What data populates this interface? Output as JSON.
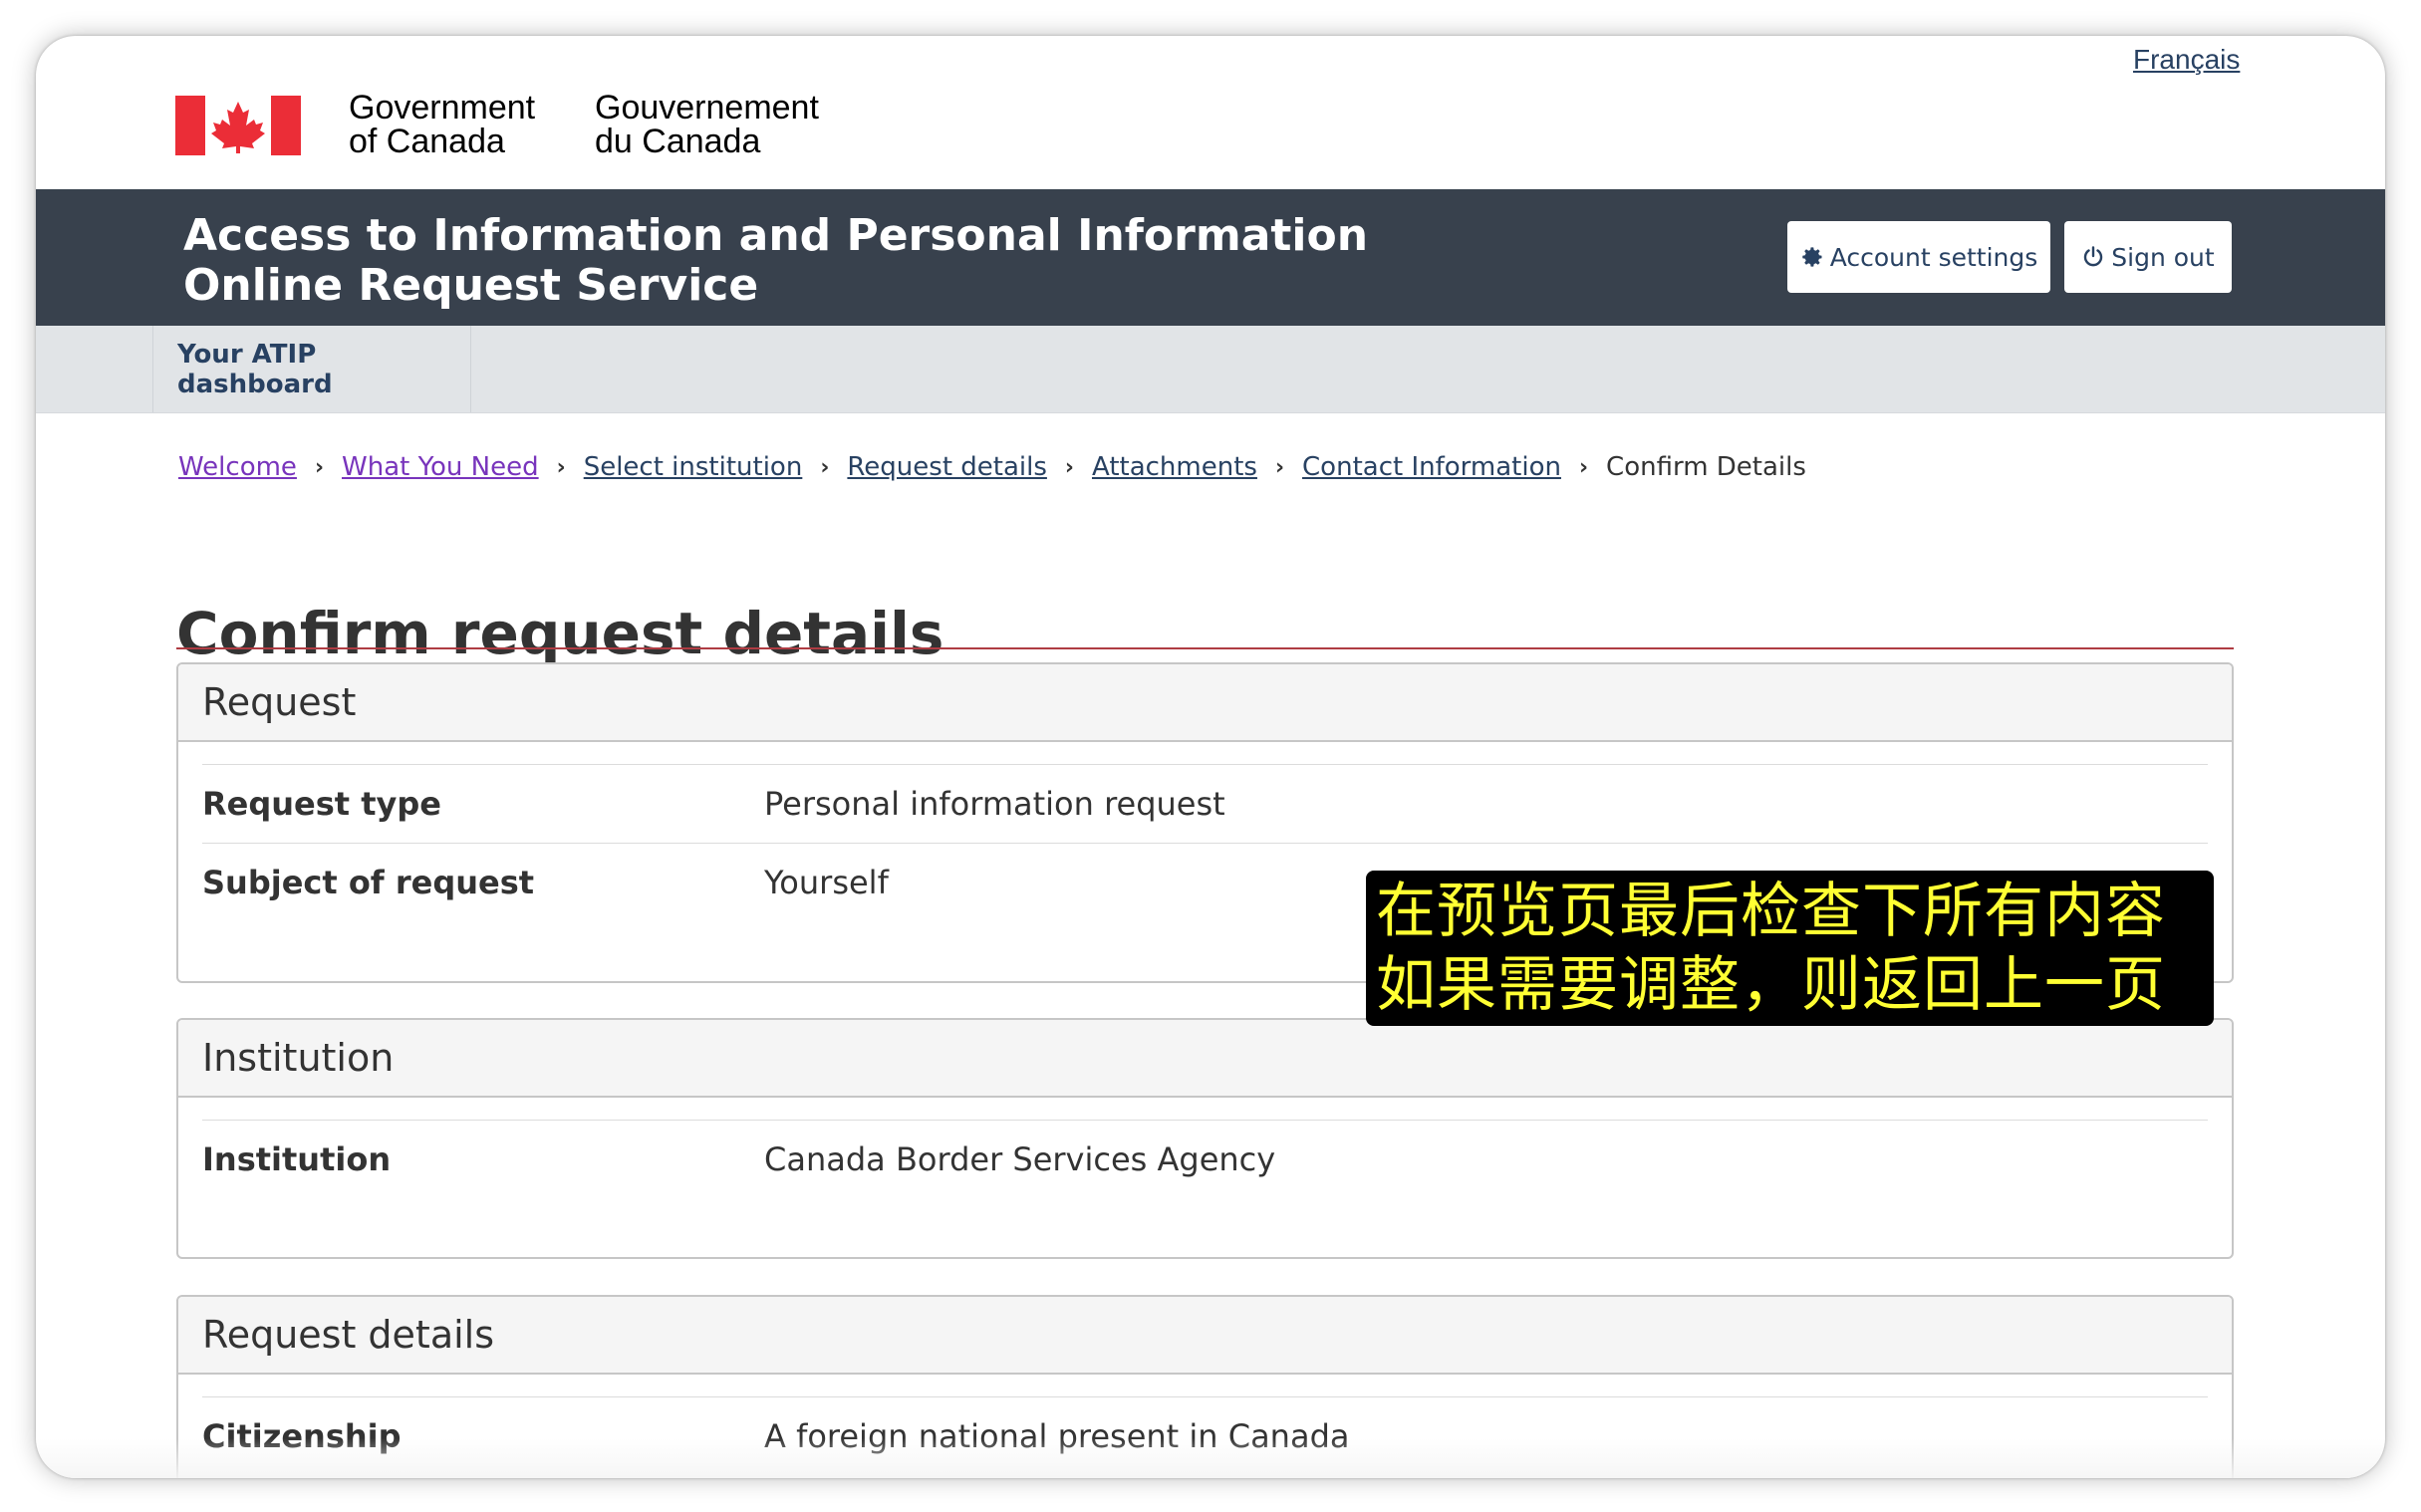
{
  "header": {
    "language_link": "Français",
    "signature": {
      "en_line1": "Government",
      "en_line2": "of Canada",
      "fr_line1": "Gouvernement",
      "fr_line2": "du Canada"
    },
    "flag_colors": {
      "red": "#eb2d37",
      "white": "#ffffff"
    }
  },
  "app_bar": {
    "title_line1": "Access to Information and Personal Information",
    "title_line2": "Online Request Service",
    "account_settings_label": "Account settings",
    "account_settings_icon": "gear-icon",
    "sign_out_label": "Sign out",
    "sign_out_icon": "power-icon"
  },
  "nav": {
    "dashboard_label": "Your ATIP dashboard"
  },
  "breadcrumb": {
    "items": [
      {
        "label": "Welcome",
        "visited": true
      },
      {
        "label": "What You Need",
        "visited": true
      },
      {
        "label": "Select institution",
        "visited": false
      },
      {
        "label": "Request details",
        "visited": false
      },
      {
        "label": "Attachments",
        "visited": false
      },
      {
        "label": "Contact Information",
        "visited": false
      }
    ],
    "current": "Confirm Details"
  },
  "main": {
    "page_title": "Confirm request details",
    "panels": [
      {
        "heading": "Request",
        "rows": [
          {
            "label": "Request type",
            "value": "Personal information request"
          },
          {
            "label": "Subject of request",
            "value": "Yourself"
          }
        ]
      },
      {
        "heading": "Institution",
        "rows": [
          {
            "label": "Institution",
            "value": "Canada Border Services Agency"
          }
        ]
      },
      {
        "heading": "Request details",
        "rows": [
          {
            "label": "Citizenship",
            "value": "A foreign national present in Canada"
          }
        ]
      }
    ]
  },
  "caption": {
    "line1": "在预览页最后检查下所有内容",
    "line2": "如果需要调整，则返回上一页",
    "text_color": "#ffff33",
    "background": "#000000"
  },
  "colors": {
    "app_bar": "#38414d",
    "nav_bar": "#e1e4e7",
    "link": "#284162",
    "visited_link": "#7834bc",
    "title_rule": "#af3c43"
  }
}
